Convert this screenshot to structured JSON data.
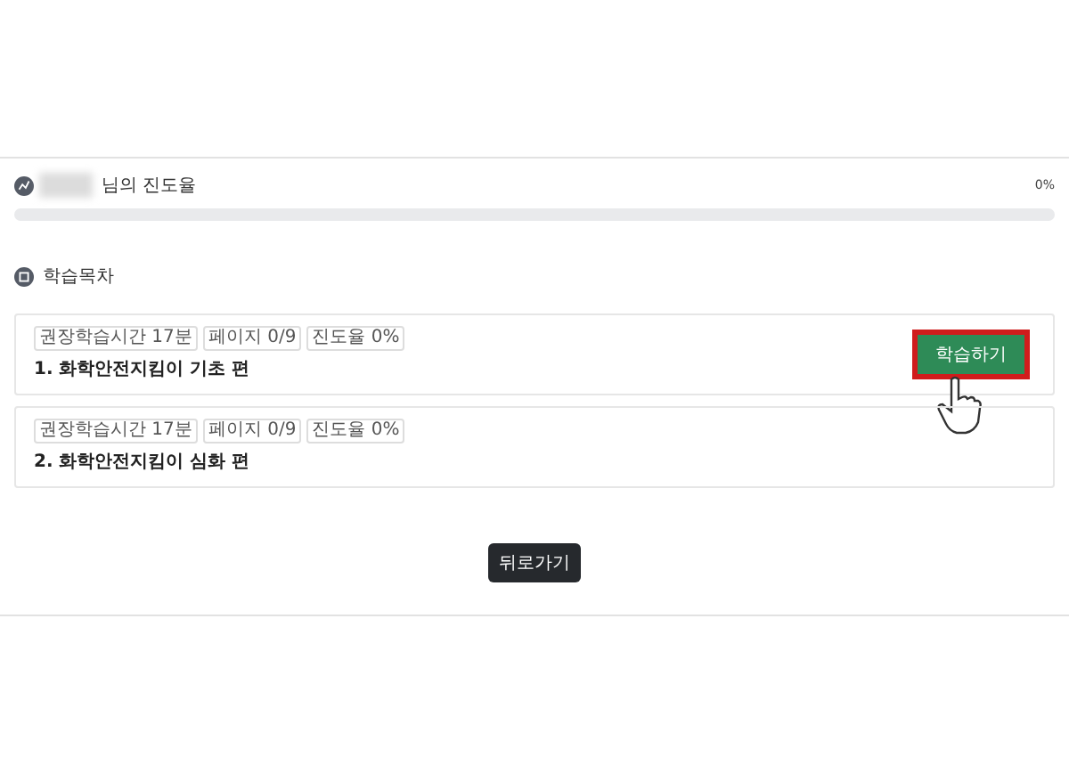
{
  "progress": {
    "title": "님의 진도율",
    "reading": "0%"
  },
  "contents": {
    "title": "학습목차"
  },
  "lessons": [
    {
      "badges": [
        "권장학습시간 17분",
        "페이지 0/9",
        "진도율 0%"
      ],
      "title": "1. 화학안전지킴이 기초 편",
      "button": "학습하기",
      "highlighted": true
    },
    {
      "badges": [
        "권장학습시간 17분",
        "페이지 0/9",
        "진도율 0%"
      ],
      "title": "2. 화학안전지킴이 심화 편"
    }
  ],
  "back_button": "뒤로가기"
}
